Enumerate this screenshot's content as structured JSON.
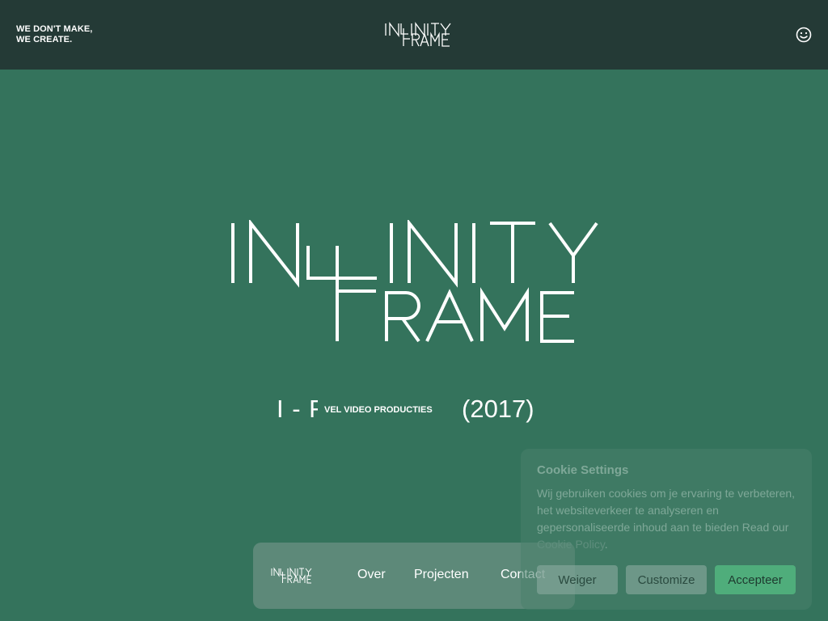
{
  "header": {
    "tagline_line1": "WE DON'T MAKE,",
    "tagline_line2": "WE CREATE.",
    "logo_top": "INFINITY",
    "logo_bottom": "FRAME"
  },
  "hero": {
    "code": "I - F",
    "subtitle": "VEL VIDEO PRODUCTIES",
    "year": "(2017)"
  },
  "nav": {
    "items": [
      "Over",
      "Projecten",
      "Contact"
    ]
  },
  "cookie": {
    "title": "Cookie Settings",
    "text": "Wij gebruiken cookies om je ervaring te verbeteren, het websiteverkeer te analyseren en gepersonaliseerde inhoud aan te bieden Read our ",
    "link": "Cookie Policy",
    "text_end": ".",
    "deny": "Weiger",
    "customize": "Customize",
    "accept": "Accepteer"
  },
  "colors": {
    "background": "#34735c",
    "header": "#243a36",
    "accept": "#4fad7b"
  }
}
